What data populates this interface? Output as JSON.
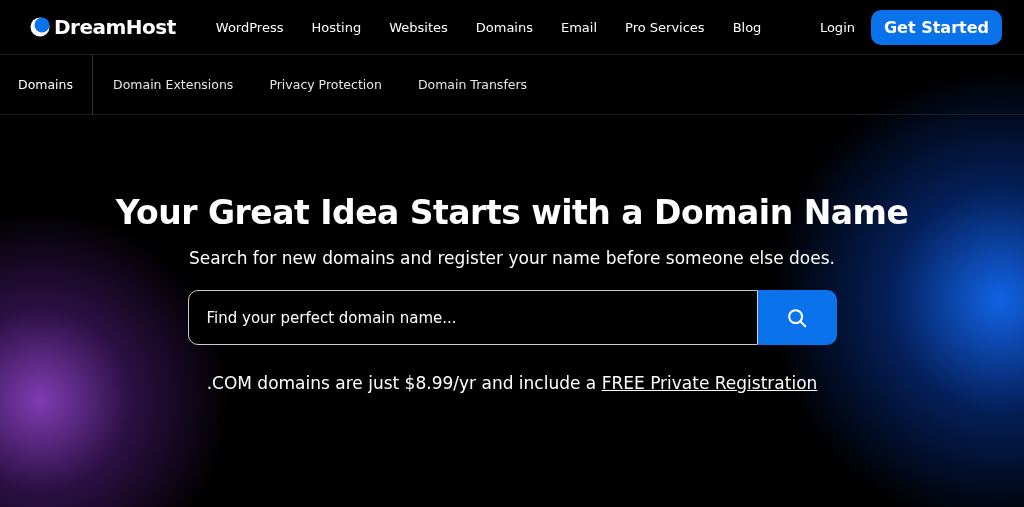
{
  "header": {
    "logo": "DreamHost",
    "nav": [
      "WordPress",
      "Hosting",
      "Websites",
      "Domains",
      "Email",
      "Pro Services",
      "Blog"
    ],
    "login": "Login",
    "cta": "Get Started"
  },
  "subnav": [
    {
      "label": "Domains",
      "selected": true
    },
    {
      "label": "Domain Extensions",
      "selected": false
    },
    {
      "label": "Privacy Protection",
      "selected": false
    },
    {
      "label": "Domain Transfers",
      "selected": false
    }
  ],
  "hero": {
    "title": "Your Great Idea Starts with a Domain Name",
    "subtitle": "Search for new domains and register your name before someone else does.",
    "search": {
      "placeholder": "Find your perfect domain name..."
    },
    "promo": {
      "text": ".COM domains are just $8.99/yr and include a ",
      "link": "FREE Private Registration"
    }
  }
}
